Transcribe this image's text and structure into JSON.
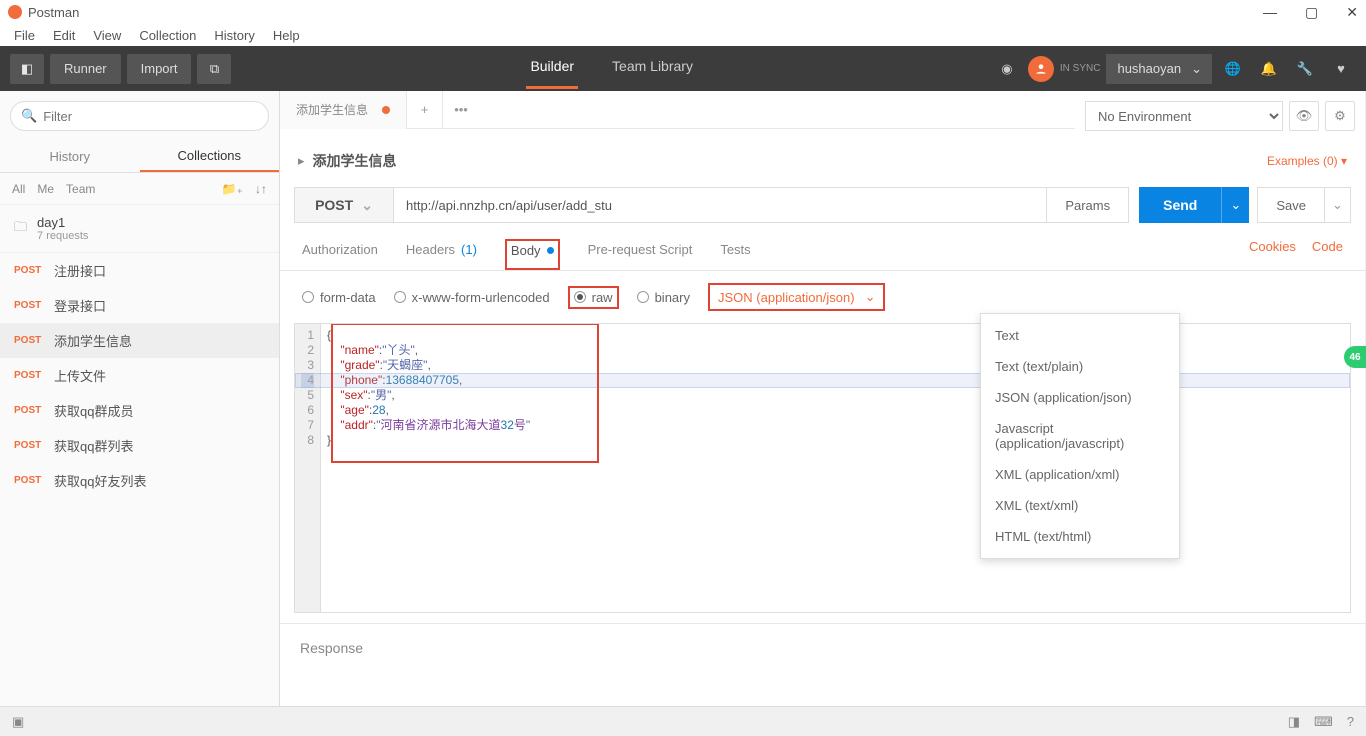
{
  "window": {
    "title": "Postman"
  },
  "menu": [
    "File",
    "Edit",
    "View",
    "Collection",
    "History",
    "Help"
  ],
  "toolbar": {
    "runner": "Runner",
    "import": "Import",
    "builder": "Builder",
    "teamlib": "Team Library",
    "sync": "IN SYNC",
    "user": "hushaoyan"
  },
  "sidebar": {
    "filter_placeholder": "Filter",
    "tabs": {
      "history": "History",
      "collections": "Collections"
    },
    "filters": [
      "All",
      "Me",
      "Team"
    ],
    "folder": {
      "name": "day1",
      "meta": "7 requests"
    },
    "items": [
      {
        "badge": "POST",
        "label": "注册接口"
      },
      {
        "badge": "POST",
        "label": "登录接口"
      },
      {
        "badge": "POST",
        "label": "添加学生信息"
      },
      {
        "badge": "POST",
        "label": "上传文件"
      },
      {
        "badge": "POST",
        "label": "获取qq群成员"
      },
      {
        "badge": "POST",
        "label": "获取qq群列表"
      },
      {
        "badge": "POST",
        "label": "获取qq好友列表"
      }
    ]
  },
  "env": {
    "none": "No Environment"
  },
  "request": {
    "tab_title": "添加学生信息",
    "title": "添加学生信息",
    "examples": "Examples (0)",
    "method": "POST",
    "url": "http://api.nnzhp.cn/api/user/add_stu",
    "params": "Params",
    "send": "Send",
    "save": "Save",
    "subtabs": {
      "auth": "Authorization",
      "headers": "Headers",
      "headers_count": "(1)",
      "body": "Body",
      "prescript": "Pre-request Script",
      "tests": "Tests",
      "cookies": "Cookies",
      "code": "Code"
    },
    "body_types": {
      "formdata": "form-data",
      "urlencoded": "x-www-form-urlencoded",
      "raw": "raw",
      "binary": "binary",
      "content_type": "JSON (application/json)"
    },
    "ct_options": [
      "Text",
      "Text (text/plain)",
      "JSON (application/json)",
      "Javascript (application/javascript)",
      "XML (application/xml)",
      "XML (text/xml)",
      "HTML (text/html)"
    ],
    "body_json": {
      "name": "丫头",
      "grade": "天蝎座",
      "phone": 13688407705,
      "sex": "男",
      "age": 28,
      "addr": "河南省济源市北海大道32号"
    }
  },
  "response": {
    "label": "Response"
  },
  "float_badge": "46"
}
